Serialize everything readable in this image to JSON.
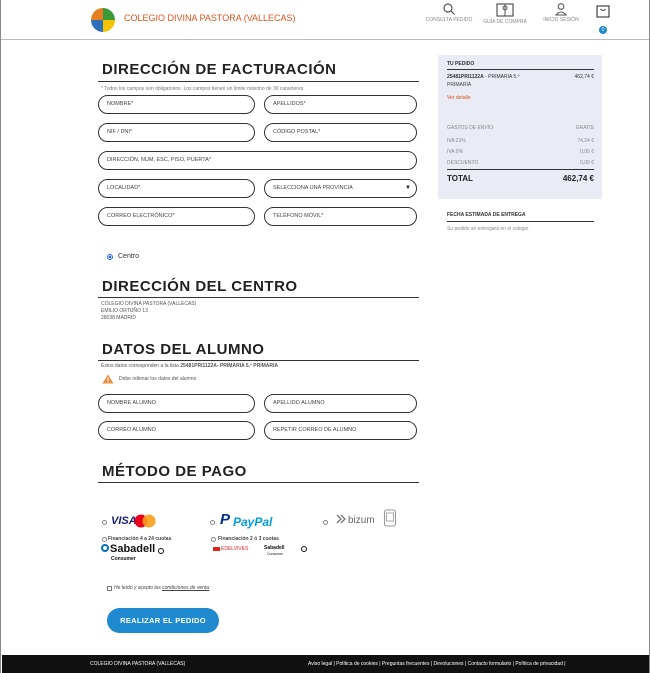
{
  "header": {
    "school_name": "COLEGIO DIVINA PASTORA (VALLECAS)",
    "nav": [
      {
        "label": "CONSULTA PEDIDO",
        "icon": "search-icon"
      },
      {
        "label": "GUÍA DE COMPRA",
        "icon": "book-icon"
      },
      {
        "label": "INICIO SESIÓN",
        "icon": "user-icon"
      }
    ],
    "cart_count": "0"
  },
  "billing": {
    "title": "DIRECCIÓN DE FACTURACIÓN",
    "note": "* Todos los campos son obligatorios. Los campos tienen un límite máximo de 30 caracteres.",
    "fields": {
      "nombre": "NOMBRE*",
      "apellidos": "APELLIDOS*",
      "nif": "NIF / DNI*",
      "cp": "CÓDIGO POSTAL*",
      "direccion": "DIRECCIÓN, NUM, ESC, PISO, PUERTA*",
      "localidad": "LOCALIDAD*",
      "provincia": "SELECCIONA UNA PROVINCIA",
      "correo": "CORREO ELECTRÓNICO*",
      "telefono": "TELÉFONO MÓVIL*"
    }
  },
  "shipping": {
    "option_label": "Centro"
  },
  "center": {
    "title": "DIRECCIÓN DEL CENTRO",
    "line1": "COLEGIO DIVINA PASTORA (VALLECAS)",
    "line2": "EMILIO ORTUÑO 13",
    "line3": "28038 MADRID"
  },
  "student": {
    "title": "DATOS DEL ALUMNO",
    "list_prefix": "Estos datos corresponden a la lista",
    "list_name": "25481PRI1122A- PRIMARIA 5.º PRIMARIA",
    "warning": "Debe rellenar los datos del alumno",
    "fields": {
      "nombre": "NOMBRE ALUMNO",
      "apellido": "APELLIDO ALUMNO",
      "correo": "CORREO ALUMNO",
      "repetir": "REPETIR CORREO DE ALUMNO"
    }
  },
  "payment": {
    "title": "MÉTODO DE PAGO",
    "visa": "VISA",
    "paypal_p": "P",
    "paypal": "PayPal",
    "bizum": "bizum",
    "fin1": "Financiación 4 a 24 cuotas",
    "fin2": "Financiación 2 ó 3 cuotas",
    "sabadell": "Sabadell",
    "consumer": "Consumer",
    "edelvives": "EDELVIVES",
    "consumer_small": "Consumer",
    "terms_prefix": "He leído y acepto las",
    "terms_link": "condiciones de venta",
    "submit": "REALIZAR EL PEDIDO"
  },
  "summary": {
    "title": "TU PEDIDO",
    "item_code": "25481PRI1122A",
    "item_desc": "- PRIMARIA 5.º",
    "item_desc2": "PRIMARIA",
    "item_price": "462,74 €",
    "detail_link": "Ver detalle",
    "rows": [
      {
        "label": "GASTOS DE ENVÍO",
        "value": "GRATIS"
      },
      {
        "label": "IVA 21%",
        "value": "74,24 €"
      },
      {
        "label": "IVA 0%",
        "value": "0,00 €"
      },
      {
        "label": "DESCUENTO",
        "value": "0,00 €"
      }
    ],
    "total_label": "TOTAL",
    "total_value": "462,74 €"
  },
  "delivery": {
    "title": "FECHA ESTIMADA DE ENTREGA",
    "text": "Su pedido se entregará en el colegio"
  },
  "footer": {
    "left": "COLEGIO DIVINA PASTORA (VALLECAS)",
    "links": "Aviso legal | Política de cookies | Preguntas frecuentes | Devoluciones | Contacto formulario | Política de privacidad |"
  },
  "colors": {
    "brand": "#d9541c",
    "accent": "#1f8ad0",
    "summary_bg": "#e9ebf5"
  }
}
